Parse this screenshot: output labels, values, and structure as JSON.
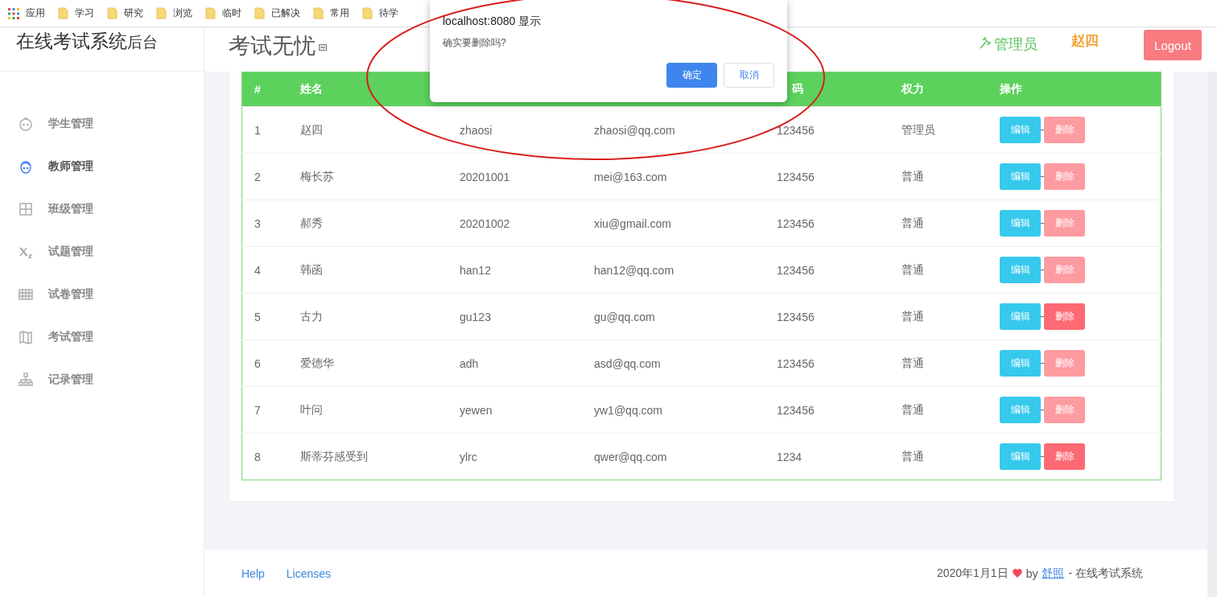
{
  "bookmarks": [
    {
      "label": "应用",
      "kind": "apps"
    },
    {
      "label": "学习",
      "kind": "folder"
    },
    {
      "label": "研究",
      "kind": "folder"
    },
    {
      "label": "浏览",
      "kind": "folder"
    },
    {
      "label": "临时",
      "kind": "folder"
    },
    {
      "label": "已解决",
      "kind": "folder"
    },
    {
      "label": "常用",
      "kind": "folder"
    },
    {
      "label": "待学",
      "kind": "folder"
    }
  ],
  "sidebar": {
    "title": "在线考试系统",
    "title_suffix": "后台",
    "items": [
      {
        "label": "学生管理",
        "selected": false
      },
      {
        "label": "教师管理",
        "selected": true
      },
      {
        "label": "班级管理",
        "selected": false
      },
      {
        "label": "试题管理",
        "selected": false
      },
      {
        "label": "试卷管理",
        "selected": false
      },
      {
        "label": "考试管理",
        "selected": false
      },
      {
        "label": "记录管理",
        "selected": false
      }
    ]
  },
  "header": {
    "title": "考试无忧",
    "role": "管理员",
    "user": "赵四",
    "logout": "Logout"
  },
  "table": {
    "columns": [
      {
        "label": "#"
      },
      {
        "label": "姓名"
      },
      {},
      {},
      {
        "label": "码"
      },
      {
        "label": "权力"
      },
      {
        "label": "操作"
      }
    ],
    "rows": [
      {
        "cells": [
          "1",
          "赵四",
          "zhaosi",
          "zhaosi@qq.com",
          "123456",
          "管理员"
        ],
        "edit": "编辑",
        "delete": "删除",
        "delete_disabled": true
      },
      {
        "cells": [
          "2",
          "梅长苏",
          "20201001",
          "mei@163.com",
          "123456",
          "普通"
        ],
        "edit": "编辑",
        "delete": "删除",
        "delete_disabled": true
      },
      {
        "cells": [
          "3",
          "郝秀",
          "20201002",
          "xiu@gmail.com",
          "123456",
          "普通"
        ],
        "edit": "编辑",
        "delete": "删除",
        "delete_disabled": true
      },
      {
        "cells": [
          "4",
          "韩函",
          "han12",
          "han12@qq.com",
          "123456",
          "普通"
        ],
        "edit": "编辑",
        "delete": "删除",
        "delete_disabled": true
      },
      {
        "cells": [
          "5",
          "古力",
          "gu123",
          "gu@qq.com",
          "123456",
          "普通"
        ],
        "edit": "编辑",
        "delete": "删除",
        "delete_disabled": false
      },
      {
        "cells": [
          "6",
          "爱德华",
          "adh",
          "asd@qq.com",
          "123456",
          "普通"
        ],
        "edit": "编辑",
        "delete": "删除",
        "delete_disabled": true
      },
      {
        "cells": [
          "7",
          "叶问",
          "yewen",
          "yw1@qq.com",
          "123456",
          "普通"
        ],
        "edit": "编辑",
        "delete": "删除",
        "delete_disabled": true
      },
      {
        "cells": [
          "8",
          "斯蒂芬感受到",
          "ylrc",
          "qwer@qq.com",
          "1234",
          "普通"
        ],
        "edit": "编辑",
        "delete": "删除",
        "delete_disabled": false
      }
    ]
  },
  "footer": {
    "links": [
      "Help",
      "Licenses"
    ],
    "date": "2020年1月1日",
    "by": "by",
    "author": "舒照",
    "tail": "- 在线考试系统"
  },
  "dialog": {
    "title": "localhost:8080 显示",
    "message": "确实要删除吗?",
    "ok": "确定",
    "cancel": "取消"
  }
}
